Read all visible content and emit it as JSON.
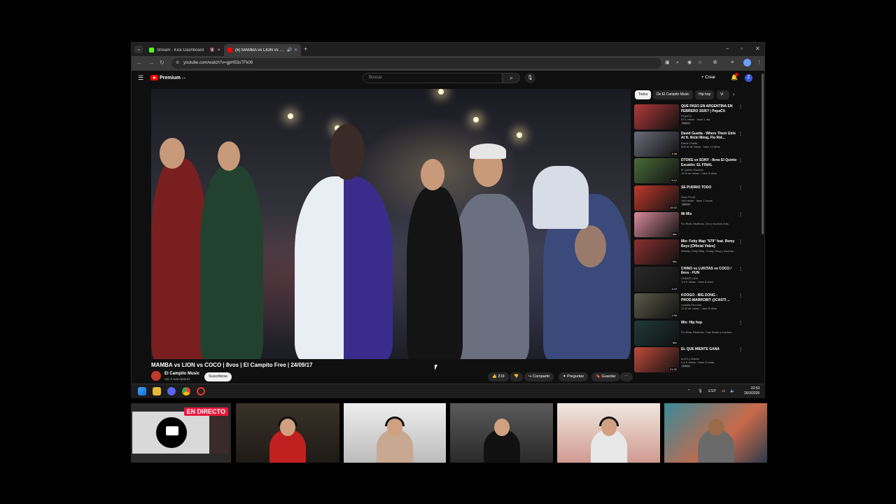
{
  "browser": {
    "tabs": [
      {
        "label": "Stream - Kick Dashboard",
        "favicon_color": "#53fc18"
      },
      {
        "label": "(6) MAMBA vs LION vs COCO",
        "favicon_color": "#ff0000"
      }
    ],
    "url": "youtube.com/watch?v=gpH53sTFk08"
  },
  "youtube": {
    "brand": "Premium",
    "brand_sup": "ES",
    "search_placeholder": "Buscar",
    "create_label": "Crear",
    "avatar_letter": "Z"
  },
  "video": {
    "title": "MAMBA vs LION vs COCO | 8vos | El Campito Free | 24/09/17",
    "channel": "El Campito Music",
    "subscribers": "101 k suscriptores",
    "subscribe_label": "Suscribirse",
    "likes": "219",
    "share_label": "Compartir",
    "ask_label": "Preguntar",
    "save_label": "Guardar"
  },
  "chips": [
    "Todos",
    "De El Campito Music",
    "Hip hop",
    "Vi"
  ],
  "recommendations": [
    {
      "title": "QUÉ PASÓ EN ARGENTINA EN FEBRERO 2026? | PepaCX",
      "channel": "PepaCX",
      "meta": "57 k vistas · hace 1 día",
      "badge": "Nuevo",
      "duration": "",
      "color": "#b23a3a"
    },
    {
      "title": "David Guetta - Where Them Girls At ft. Nicki Minaj, Flo Rid...",
      "channel": "David Guetta",
      "meta": "903 M de vistas · hace 14 años",
      "badge": "",
      "duration": "3:48",
      "color": "#6b6b7a"
    },
    {
      "title": "DTOKE vs SONY - 8vos El Quinto Escalón: EL FINAL",
      "channel": "El Quinto Escalón",
      "meta": "19 M de vistas · hace 8 años",
      "badge": "",
      "duration": "9:12",
      "color": "#4a6b3a"
    },
    {
      "title": "SE PUDRIÓ TODO",
      "channel": "Zeko PLUS",
      "meta": "148 vistas · hace 7 horas",
      "badge": "Nuevo",
      "duration": "29:32",
      "color": "#c0392b"
    },
    {
      "title": "Mi Mix",
      "channel": "Flo Rida, Bluefuss, Ovi y muchos más",
      "meta": "",
      "badge": "",
      "duration": "Mix",
      "color": "#d98a9a"
    },
    {
      "title": "Mix: Fetty Wap \"679\" feat. Remy Boyz [Official Video]",
      "channel": "Weekly, Fetty Wap, Young Thug y muchos...",
      "meta": "",
      "badge": "",
      "duration": "Mix",
      "color": "#8a3030"
    },
    {
      "title": "CHINO vs LUKITAS vs COCO / 8vos - FUN",
      "channel": "UNDER LUKI",
      "meta": "1,5 K vistas · hace 8 años",
      "badge": "",
      "duration": "3:16",
      "color": "#2a2a2a"
    },
    {
      "title": "KOOGO - BIG DONG - PROD.MARROBIT @CASTI ...",
      "channel": "Costilla Records",
      "meta": "23 M de vistas · hace 8 años",
      "badge": "",
      "duration": "2:58",
      "color": "#5a5a4a"
    },
    {
      "title": "Mix: Hip hop",
      "channel": "Flo Rida, Bluefuss, Trap Beats y muchos...",
      "meta": "",
      "badge": "",
      "duration": "Mix",
      "color": "#1f3a3a"
    },
    {
      "title": "EL QUE MIENTE GANA",
      "channel": "eLKS y Odeks",
      "meta": "6,4 K vistas · hace 4 horas",
      "badge": "Nuevo",
      "duration": "21:32",
      "color": "#c04a3a"
    }
  ],
  "taskbar": {
    "lang": "ESP",
    "time": "22:53",
    "date": "26/3/2026"
  },
  "cams": {
    "live_label": "EN DIRECTO"
  }
}
